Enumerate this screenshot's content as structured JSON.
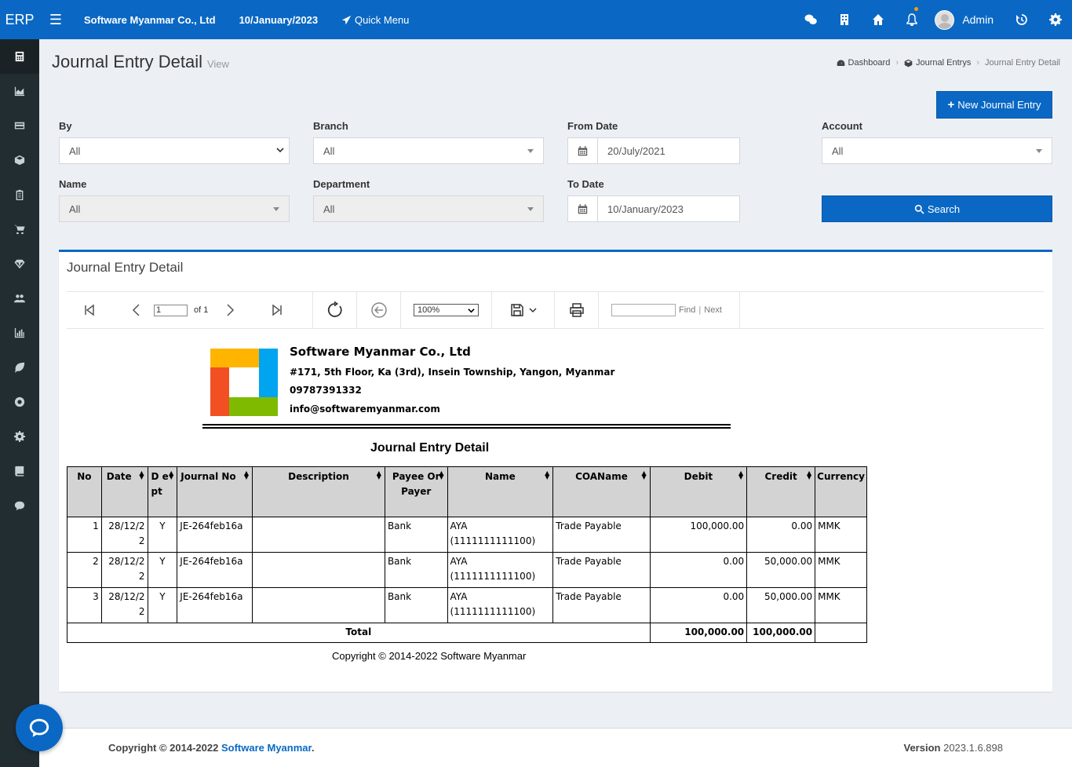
{
  "header": {
    "logo": "ERP",
    "company": "Software Myanmar Co., Ltd",
    "date": "10/January/2023",
    "quick_menu": "Quick Menu",
    "user": "Admin"
  },
  "page": {
    "title": "Journal Entry Detail",
    "subtitle": "View",
    "breadcrumb": [
      "Dashboard",
      "Journal Entrys",
      "Journal Entry Detail"
    ],
    "new_button": "New Journal Entry"
  },
  "filters": {
    "by": {
      "label": "By",
      "value": "All"
    },
    "branch": {
      "label": "Branch",
      "value": "All"
    },
    "from_date": {
      "label": "From Date",
      "value": "20/July/2021"
    },
    "account": {
      "label": "Account",
      "value": "All"
    },
    "name": {
      "label": "Name",
      "value": "All"
    },
    "department": {
      "label": "Department",
      "value": "All"
    },
    "to_date": {
      "label": "To Date",
      "value": "10/January/2023"
    },
    "search": "Search"
  },
  "box": {
    "title": "Journal Entry Detail"
  },
  "toolbar": {
    "page": "1",
    "of": "of 1",
    "zoom": "100%",
    "find": "Find",
    "next": "Next"
  },
  "report": {
    "company": "Software Myanmar Co., Ltd",
    "address": "#171, 5th Floor, Ka (3rd), Insein Township, Yangon, Myanmar",
    "phone": "09787391332",
    "email": "info@softwaremyanmar.com",
    "title": "Journal Entry Detail",
    "columns": [
      "No",
      "Date",
      "D e pt",
      "Journal No",
      "Description",
      "Payee Or Payer",
      "Name",
      "COAName",
      "Debit",
      "Credit",
      "Currency"
    ],
    "rows": [
      {
        "no": "1",
        "date": "28/12/22",
        "dept": "Y",
        "journal_no": "JE-264feb16a",
        "description": "",
        "payee": "Bank",
        "name": "AYA (1111111111100)",
        "coa": "Trade Payable",
        "debit": "100,000.00",
        "credit": "0.00",
        "currency": "MMK"
      },
      {
        "no": "2",
        "date": "28/12/22",
        "dept": "Y",
        "journal_no": "JE-264feb16a",
        "description": "",
        "payee": "Bank",
        "name": "AYA (1111111111100)",
        "coa": "Trade Payable",
        "debit": "0.00",
        "credit": "50,000.00",
        "currency": "MMK"
      },
      {
        "no": "3",
        "date": "28/12/22",
        "dept": "Y",
        "journal_no": "JE-264feb16a",
        "description": "",
        "payee": "Bank",
        "name": "AYA (1111111111100)",
        "coa": "Trade Payable",
        "debit": "0.00",
        "credit": "50,000.00",
        "currency": "MMK"
      }
    ],
    "total_label": "Total",
    "total_debit": "100,000.00",
    "total_credit": "100,000.00",
    "copyright": "Copyright © 2014-2022 Software Myanmar"
  },
  "footer": {
    "copyright_prefix": "Copyright © 2014-2022",
    "company_link": "Software Myanmar",
    "dot": ".",
    "version_label": "Version",
    "version": "2023.1.6.898"
  },
  "colors": {
    "primary": "#0a68c4",
    "sidebar": "#222d32",
    "background": "#ecf0f5"
  },
  "sidebar_icons": [
    "calculator-icon",
    "area-chart-icon",
    "credit-card-icon",
    "cube-icon",
    "clipboard-icon",
    "cart-icon",
    "diamond-icon",
    "users-icon",
    "bar-chart-icon",
    "leaf-icon",
    "life-ring-icon",
    "gear-icon",
    "book-icon",
    "comment-icon"
  ]
}
